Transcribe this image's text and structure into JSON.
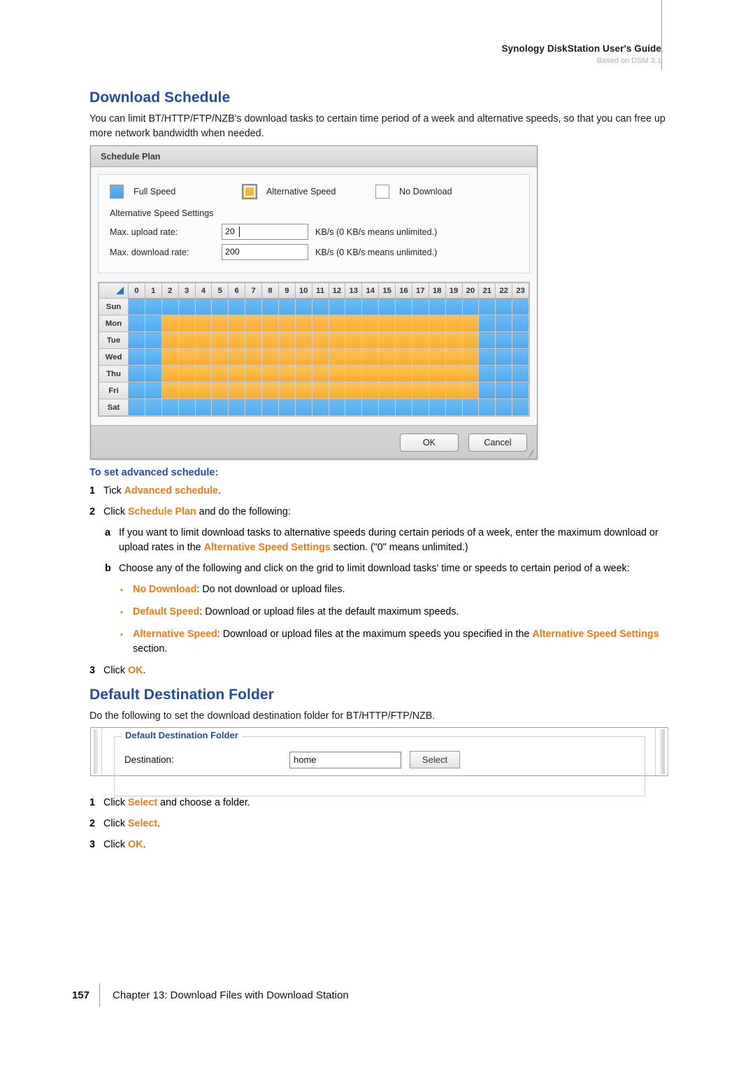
{
  "header": {
    "title": "Synology DiskStation User's Guide",
    "subtitle": "Based on DSM 3.1"
  },
  "sections": {
    "schedule": {
      "heading": "Download Schedule",
      "intro": "You can limit BT/HTTP/FTP/NZB's download tasks to certain time period of a week and alternative speeds, so that you can free up more network bandwidth when needed."
    },
    "destination": {
      "heading": "Default Destination Folder",
      "intro": "Do the following to set the download destination folder for BT/HTTP/FTP/NZB."
    }
  },
  "dialog": {
    "title": "Schedule Plan",
    "legend": [
      {
        "label": "Full Speed",
        "swatch": "blue",
        "selected": false
      },
      {
        "label": "Alternative Speed",
        "swatch": "orange",
        "selected": true
      },
      {
        "label": "No Download",
        "swatch": "white",
        "selected": false
      }
    ],
    "alt_settings_title": "Alternative Speed Settings",
    "fields": [
      {
        "label": "Max. upload rate:",
        "value": "20",
        "unit": "KB/s (0 KB/s means unlimited.)",
        "focused": true
      },
      {
        "label": "Max. download rate:",
        "value": "200",
        "unit": "KB/s (0 KB/s means unlimited.)",
        "focused": false
      }
    ],
    "buttons": {
      "ok": "OK",
      "cancel": "Cancel"
    }
  },
  "schedule_grid": {
    "hours": [
      "0",
      "1",
      "2",
      "3",
      "4",
      "5",
      "6",
      "7",
      "8",
      "9",
      "10",
      "11",
      "12",
      "13",
      "14",
      "15",
      "16",
      "17",
      "18",
      "19",
      "20",
      "21",
      "22",
      "23"
    ],
    "days": [
      "Sun",
      "Mon",
      "Tue",
      "Wed",
      "Thu",
      "Fri",
      "Sat"
    ],
    "colors": {
      "full": "#4ea9ec",
      "alt": "#f9ab2e",
      "none": "#ffffff"
    },
    "rows": [
      {
        "day": "Sun",
        "cells": [
          "full",
          "full",
          "full",
          "full",
          "full",
          "full",
          "full",
          "full",
          "full",
          "full",
          "full",
          "full",
          "full",
          "full",
          "full",
          "full",
          "full",
          "full",
          "full",
          "full",
          "full",
          "full",
          "full",
          "full"
        ]
      },
      {
        "day": "Mon",
        "cells": [
          "full",
          "full",
          "alt",
          "alt",
          "alt",
          "alt",
          "alt",
          "alt",
          "alt",
          "alt",
          "alt",
          "alt",
          "alt",
          "alt",
          "alt",
          "alt",
          "alt",
          "alt",
          "alt",
          "alt",
          "alt",
          "full",
          "full",
          "full"
        ]
      },
      {
        "day": "Tue",
        "cells": [
          "full",
          "full",
          "alt",
          "alt",
          "alt",
          "alt",
          "alt",
          "alt",
          "alt",
          "alt",
          "alt",
          "alt",
          "alt",
          "alt",
          "alt",
          "alt",
          "alt",
          "alt",
          "alt",
          "alt",
          "alt",
          "full",
          "full",
          "full"
        ]
      },
      {
        "day": "Wed",
        "cells": [
          "full",
          "full",
          "alt",
          "alt",
          "alt",
          "alt",
          "alt",
          "alt",
          "alt",
          "alt",
          "alt",
          "alt",
          "alt",
          "alt",
          "alt",
          "alt",
          "alt",
          "alt",
          "alt",
          "alt",
          "alt",
          "full",
          "full",
          "full"
        ]
      },
      {
        "day": "Thu",
        "cells": [
          "full",
          "full",
          "alt",
          "alt",
          "alt",
          "alt",
          "alt",
          "alt",
          "alt",
          "alt",
          "alt",
          "alt",
          "alt",
          "alt",
          "alt",
          "alt",
          "alt",
          "alt",
          "alt",
          "alt",
          "alt",
          "full",
          "full",
          "full"
        ]
      },
      {
        "day": "Fri",
        "cells": [
          "full",
          "full",
          "alt",
          "alt",
          "alt",
          "alt",
          "alt",
          "alt",
          "alt",
          "alt",
          "alt",
          "alt",
          "alt",
          "alt",
          "alt",
          "alt",
          "alt",
          "alt",
          "alt",
          "alt",
          "alt",
          "full",
          "full",
          "full"
        ]
      },
      {
        "day": "Sat",
        "cells": [
          "full",
          "full",
          "full",
          "full",
          "full",
          "full",
          "full",
          "full",
          "full",
          "full",
          "full",
          "full",
          "full",
          "full",
          "full",
          "full",
          "full",
          "full",
          "full",
          "full",
          "full",
          "full",
          "full",
          "full"
        ]
      }
    ]
  },
  "schedule_steps": {
    "heading": "To set advanced schedule:",
    "step1": {
      "num": "1",
      "pre": "Tick ",
      "hl": "Advanced schedule",
      "post": "."
    },
    "step2": {
      "num": "2",
      "pre": "Click ",
      "hl": "Schedule Plan",
      "post": " and do the following:"
    },
    "step_a": {
      "num": "a",
      "pre": "If you want to limit download tasks to alternative speeds during certain periods of a week, enter the maximum download or upload rates in the ",
      "hl": "Alternative Speed Settings",
      "post": " section. (\"0\" means unlimited.)"
    },
    "step_b": {
      "num": "b",
      "text": "Choose any of the following and click on the grid to limit download tasks' time or speeds to certain period of a week:"
    },
    "bullets": [
      {
        "hl": "No Download",
        "text": ": Do not download or upload files.",
        "hl2": "",
        "text2": ""
      },
      {
        "hl": "Default Speed",
        "text": ": Download or upload files at the default maximum speeds.",
        "hl2": "",
        "text2": ""
      },
      {
        "hl": "Alternative Speed",
        "text": ": Download or upload files at the maximum speeds you specified in the ",
        "hl2": "Alternative Speed Settings",
        "text2": " section."
      }
    ],
    "step3": {
      "num": "3",
      "pre": "Click ",
      "hl": "OK",
      "post": "."
    }
  },
  "dest_panel": {
    "legend": "Default Destination Folder",
    "label": "Destination:",
    "value": "home",
    "button": "Select"
  },
  "dest_steps": [
    {
      "num": "1",
      "pre": "Click ",
      "hl": "Select",
      "post": " and choose a folder."
    },
    {
      "num": "2",
      "pre": "Click ",
      "hl": "Select",
      "post": "."
    },
    {
      "num": "3",
      "pre": "Click ",
      "hl": "OK",
      "post": "."
    }
  ],
  "footer": {
    "page_number": "157",
    "chapter": "Chapter 13: Download Files with Download Station"
  }
}
